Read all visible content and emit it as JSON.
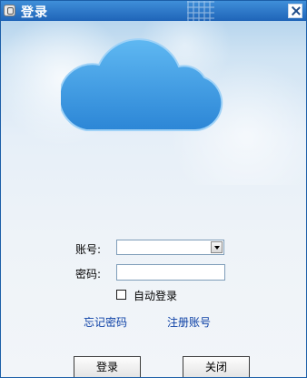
{
  "window": {
    "title": "登录"
  },
  "form": {
    "account_label": "账号:",
    "password_label": "密码:",
    "account_value": "",
    "password_value": "",
    "auto_login_label": "自动登录",
    "auto_login_checked": false
  },
  "links": {
    "forgot_password": "忘记密码",
    "register_account": "注册账号"
  },
  "buttons": {
    "login": "登录",
    "close": "关闭"
  },
  "colors": {
    "titlebar": "#2a74c6",
    "cloud": "#3f9ee3",
    "link": "#0b3fa5"
  }
}
